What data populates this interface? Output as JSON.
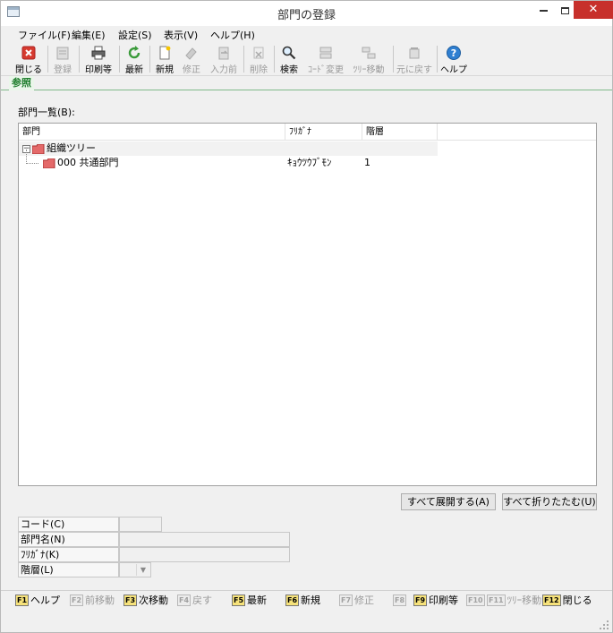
{
  "window": {
    "title": "部門の登録"
  },
  "menu": [
    {
      "label": "ファイル(F)"
    },
    {
      "label": "編集(E)"
    },
    {
      "label": "設定(S)"
    },
    {
      "label": "表示(V)"
    },
    {
      "label": "ヘルプ(H)"
    }
  ],
  "toolbar": {
    "buttons": [
      {
        "label": "閉じる",
        "icon": "close-icon",
        "enabled": true
      },
      {
        "label": "登録",
        "icon": "register-icon",
        "enabled": false
      },
      {
        "label": "印刷等",
        "icon": "print-icon",
        "enabled": true
      },
      {
        "label": "最新",
        "icon": "refresh-icon",
        "enabled": true
      },
      {
        "label": "新規",
        "icon": "new-icon",
        "enabled": true
      },
      {
        "label": "修正",
        "icon": "edit-icon",
        "enabled": false
      },
      {
        "label": "入力前",
        "icon": "undo-input-icon",
        "enabled": false
      },
      {
        "label": "削除",
        "icon": "delete-icon",
        "enabled": false
      },
      {
        "label": "検索",
        "icon": "search-icon",
        "enabled": true
      },
      {
        "label": "ｺｰﾄﾞ変更",
        "icon": "code-change-icon",
        "enabled": false
      },
      {
        "label": "ﾂﾘｰ移動",
        "icon": "tree-move-icon",
        "enabled": false
      },
      {
        "label": "元に戻す",
        "icon": "revert-icon",
        "enabled": false
      },
      {
        "label": "ヘルプ",
        "icon": "help-icon",
        "enabled": true
      }
    ]
  },
  "tab": {
    "label": "参照"
  },
  "list": {
    "label": "部門一覧(B):",
    "columns": [
      "部門",
      "ﾌﾘｶﾞﾅ",
      "階層"
    ],
    "root": {
      "toggle": "−",
      "label": "組織ツリー"
    },
    "rows": [
      {
        "name": "000 共通部門",
        "kana": "ｷｮｳﾂｳﾌﾞﾓﾝ",
        "level": "1"
      }
    ]
  },
  "buttons": {
    "expand_all": "すべて展開する(A)",
    "collapse_all": "すべて折りたたむ(U)"
  },
  "form": {
    "code_label": "コード(C)",
    "name_label": "部門名(N)",
    "kana_label": "ﾌﾘｶﾞﾅ(K)",
    "level_label": "階層(L)",
    "code_value": "",
    "name_value": "",
    "kana_value": "",
    "level_value": ""
  },
  "fkeys": [
    {
      "key": "F1",
      "label": "ヘルプ",
      "enabled": true
    },
    {
      "key": "F2",
      "label": "前移動",
      "enabled": false
    },
    {
      "key": "F3",
      "label": "次移動",
      "enabled": true
    },
    {
      "key": "F4",
      "label": "戻す",
      "enabled": false
    },
    {
      "key": "F5",
      "label": "最新",
      "enabled": true
    },
    {
      "key": "F6",
      "label": "新規",
      "enabled": true
    },
    {
      "key": "F7",
      "label": "修正",
      "enabled": false
    },
    {
      "key": "F8",
      "label": "",
      "enabled": false
    },
    {
      "key": "F9",
      "label": "印刷等",
      "enabled": true
    },
    {
      "key": "F10",
      "label": "",
      "enabled": false
    },
    {
      "key": "F11",
      "label": "ﾂﾘｰ移動",
      "enabled": false
    },
    {
      "key": "F12",
      "label": "閉じる",
      "enabled": true
    }
  ],
  "colors": {
    "close_button": "#c7302b",
    "tab_text": "#1d7d2b",
    "fkey_badge": "#f6e27a",
    "disabled_text": "#9a9a9a"
  }
}
